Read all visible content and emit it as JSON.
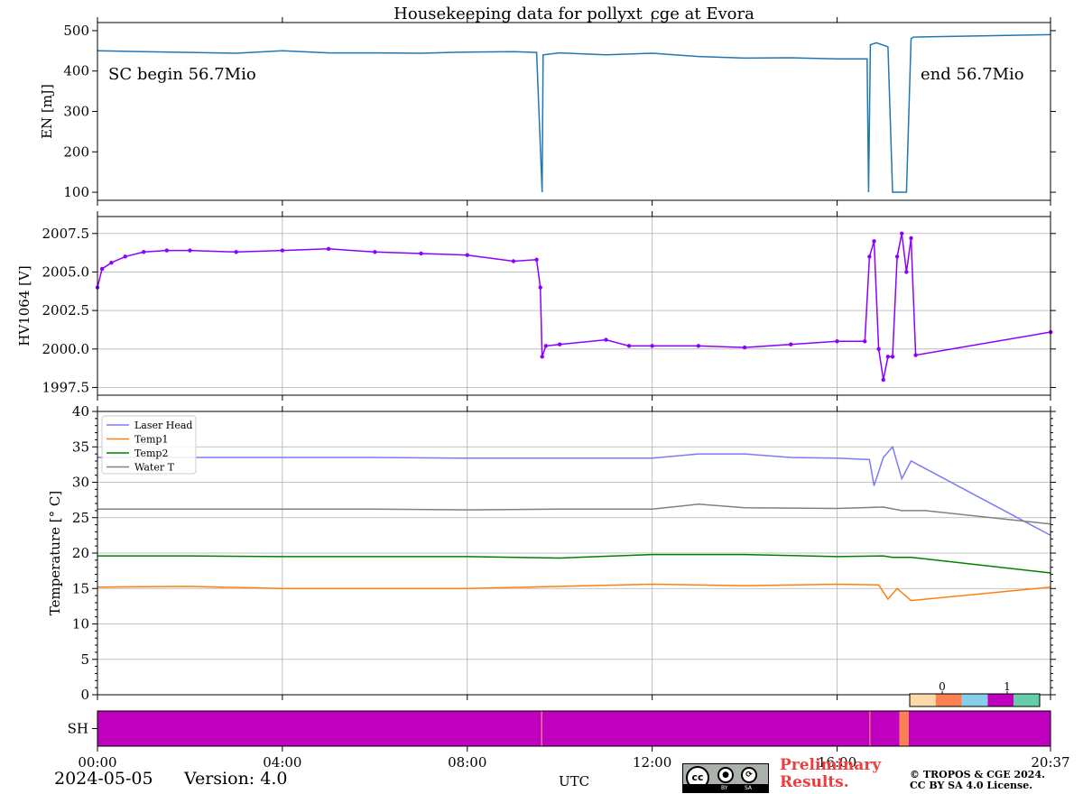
{
  "chart_data": {
    "type": "line",
    "title": "Housekeeping data for pollyxt_cge at Evora",
    "x_axis": {
      "range": [
        "00:00",
        "20:37"
      ],
      "ticks": [
        "00:00",
        "04:00",
        "08:00",
        "12:00",
        "16:00",
        "20:37"
      ],
      "label": "UTC"
    },
    "panels": [
      {
        "id": "energy",
        "ylabel": "EN [mJ]",
        "ylim": [
          80,
          520
        ],
        "yticks": [
          "100",
          "200",
          "300",
          "400",
          "500"
        ],
        "grid": false,
        "annotations": [
          "SC begin 56.7Mio",
          "end 56.7Mio"
        ],
        "series": [
          {
            "color": "#1f77b4",
            "x_hours": [
              0.0,
              1.0,
              2.0,
              3.0,
              4.0,
              5.0,
              6.0,
              7.0,
              8.0,
              9.0,
              9.5,
              9.62,
              9.64,
              10.0,
              11.0,
              12.0,
              13.0,
              14.0,
              15.0,
              16.0,
              16.65,
              16.68,
              16.72,
              16.85,
              17.1,
              17.2,
              17.25,
              17.5,
              17.6,
              17.65,
              20.62
            ],
            "values": [
              450,
              448,
              446,
              444,
              450,
              445,
              445,
              444,
              447,
              448,
              446,
              100,
              440,
              445,
              440,
              444,
              436,
              432,
              433,
              430,
              430,
              100,
              465,
              470,
              460,
              100,
              100,
              100,
              480,
              484,
              490
            ]
          }
        ]
      },
      {
        "id": "hv1064",
        "ylabel": "HV1064 [V]",
        "ylim": [
          1997.0,
          2008.6
        ],
        "yticks": [
          "1997.5",
          "2000.0",
          "2002.5",
          "2005.0",
          "2007.5"
        ],
        "grid": true,
        "series": [
          {
            "color": "#8b00ff",
            "markers": true,
            "x_hours": [
              0.0,
              0.1,
              0.3,
              0.6,
              1.0,
              1.5,
              2.0,
              3.0,
              4.0,
              5.0,
              6.0,
              7.0,
              8.0,
              9.0,
              9.5,
              9.58,
              9.62,
              9.7,
              10.0,
              11.0,
              11.5,
              12.0,
              13.0,
              14.0,
              15.0,
              16.0,
              16.6,
              16.7,
              16.8,
              16.9,
              17.0,
              17.1,
              17.2,
              17.3,
              17.4,
              17.5,
              17.6,
              17.7,
              20.62
            ],
            "values": [
              2004.0,
              2005.2,
              2005.6,
              2006.0,
              2006.3,
              2006.4,
              2006.4,
              2006.3,
              2006.4,
              2006.5,
              2006.3,
              2006.2,
              2006.1,
              2005.7,
              2005.8,
              2004.0,
              1999.5,
              2000.2,
              2000.3,
              2000.6,
              2000.2,
              2000.2,
              2000.2,
              2000.1,
              2000.3,
              2000.5,
              2000.5,
              2006.0,
              2007.0,
              2000.0,
              1998.0,
              1999.5,
              1999.5,
              2006.0,
              2007.5,
              2005.0,
              2007.2,
              1999.6,
              2001.1
            ]
          }
        ]
      },
      {
        "id": "temperature",
        "ylabel": "Temperature [$^\\circ C$]",
        "ylim": [
          0,
          40
        ],
        "yticks": [
          "0",
          "5",
          "10",
          "15",
          "20",
          "25",
          "30",
          "35",
          "40"
        ],
        "grid": true,
        "legend_location": "top-left",
        "series": [
          {
            "name": "Laser Head",
            "color": "#7b7bf7",
            "x_hours": [
              0,
              2,
              4,
              6,
              8,
              10,
              12,
              13,
              14,
              15,
              16,
              16.7,
              16.8,
              17.0,
              17.2,
              17.4,
              17.6,
              20.62
            ],
            "values": [
              33.5,
              33.5,
              33.5,
              33.5,
              33.4,
              33.4,
              33.4,
              34.0,
              34.0,
              33.5,
              33.4,
              33.2,
              29.5,
              33.5,
              35.0,
              30.5,
              33.0,
              22.5
            ]
          },
          {
            "name": "Temp1",
            "color": "#ff7f0e",
            "x_hours": [
              0,
              2,
              4,
              6,
              8,
              10,
              12,
              14,
              16,
              16.9,
              17.1,
              17.3,
              17.6,
              20.62
            ],
            "values": [
              15.2,
              15.3,
              15.0,
              15.0,
              15.0,
              15.3,
              15.6,
              15.4,
              15.6,
              15.5,
              13.5,
              15.0,
              13.3,
              15.2
            ]
          },
          {
            "name": "Temp2",
            "color": "#008000",
            "x_hours": [
              0,
              2,
              4,
              6,
              8,
              10,
              12,
              14,
              16,
              17.0,
              17.2,
              17.6,
              20.62
            ],
            "values": [
              19.6,
              19.6,
              19.5,
              19.5,
              19.5,
              19.3,
              19.8,
              19.8,
              19.5,
              19.6,
              19.4,
              19.4,
              17.2
            ]
          },
          {
            "name": "Water T",
            "color": "#808080",
            "x_hours": [
              0,
              2,
              4,
              6,
              8,
              10,
              12,
              13,
              14,
              16,
              17,
              17.4,
              17.9,
              20.62
            ],
            "values": [
              26.2,
              26.2,
              26.2,
              26.2,
              26.1,
              26.2,
              26.2,
              26.9,
              26.4,
              26.3,
              26.5,
              26.0,
              26.0,
              24.1
            ]
          }
        ]
      },
      {
        "id": "shutter",
        "ylabel": "SH",
        "type": "state-bar",
        "colorbar_ticks": [
          "0",
          "1"
        ],
        "colorbar_colors": [
          "#fbd9a8",
          "#fb8150",
          "#87ceeb",
          "#bf00bf",
          "#66cdaa"
        ],
        "segments": [
          {
            "start": 0.0,
            "end": 9.6,
            "color": "#bf00bf"
          },
          {
            "start": 9.6,
            "end": 9.62,
            "color": "#fb8150"
          },
          {
            "start": 9.62,
            "end": 16.7,
            "color": "#bf00bf"
          },
          {
            "start": 16.7,
            "end": 16.72,
            "color": "#fb8150"
          },
          {
            "start": 16.72,
            "end": 17.35,
            "color": "#bf00bf"
          },
          {
            "start": 17.35,
            "end": 17.55,
            "color": "#fb8150"
          },
          {
            "start": 17.55,
            "end": 20.62,
            "color": "#bf00bf"
          }
        ]
      }
    ]
  },
  "footer": {
    "date": "2024-05-05",
    "version": "Version: 4.0",
    "preliminary_line1": "Preliminary",
    "preliminary_line2": "Results.",
    "copyright_line1": "© TROPOS & CGE 2024.",
    "copyright_line2": "CC BY SA 4.0 License.",
    "cc_badge": {
      "main": "cc",
      "by": "BY",
      "sa": "SA"
    }
  }
}
